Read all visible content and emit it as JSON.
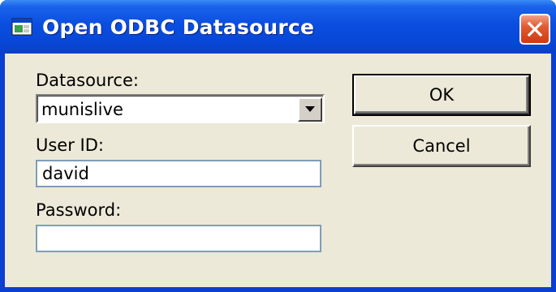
{
  "window": {
    "title": "Open ODBC Datasource"
  },
  "form": {
    "datasource_label": "Datasource:",
    "datasource_value": "munislive",
    "userid_label": "User ID:",
    "userid_value": "david",
    "password_label": "Password:",
    "password_value": ""
  },
  "buttons": {
    "ok_label": "OK",
    "cancel_label": "Cancel"
  },
  "icons": {
    "app_icon": "odbc-window-icon",
    "close_icon": "close-icon",
    "dropdown_icon": "chevron-down-icon"
  },
  "colors": {
    "titlebar": "#0a4ee0",
    "client": "#ece9d8",
    "close_button": "#e25b32"
  }
}
